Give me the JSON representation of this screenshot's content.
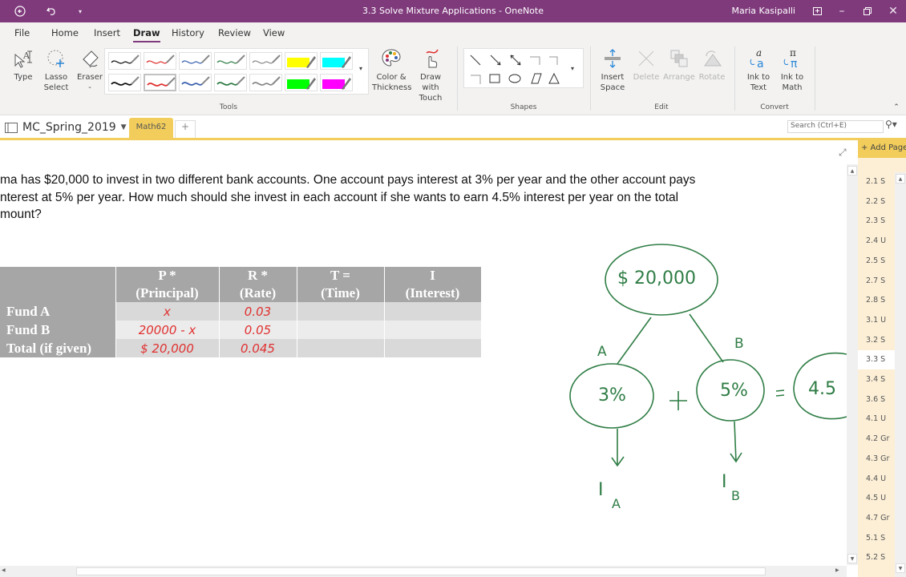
{
  "window": {
    "title": "3.3 Solve Mixture Applications  -  OneNote",
    "user": "Maria Kasipalli"
  },
  "menu": {
    "tabs": [
      "File",
      "Home",
      "Insert",
      "Draw",
      "History",
      "Review",
      "View"
    ],
    "active": "Draw"
  },
  "ribbon": {
    "tools": {
      "type_label": "Type",
      "lasso_label1": "Lasso",
      "lasso_label2": "Select",
      "eraser_label": "Eraser",
      "eraser_sub": "-",
      "color_label1": "Color &",
      "color_label2": "Thickness",
      "touch_label1": "Draw with",
      "touch_label2": "Touch",
      "group": "Tools"
    },
    "pens": [
      {
        "color": "#111111",
        "kind": "pen"
      },
      {
        "color": "#e0302f",
        "kind": "pen"
      },
      {
        "color": "#3b62b0",
        "kind": "pen"
      },
      {
        "color": "#2f7d45",
        "kind": "pen"
      },
      {
        "color": "#8a8a8a",
        "kind": "pen"
      },
      {
        "color": "#ffff00",
        "kind": "highlighter"
      },
      {
        "color": "#00ffff",
        "kind": "highlighter"
      },
      {
        "color": "#111111",
        "kind": "pen"
      },
      {
        "color": "#e0302f",
        "kind": "pen",
        "selected": true
      },
      {
        "color": "#3b62b0",
        "kind": "pen"
      },
      {
        "color": "#2f7d45",
        "kind": "pen"
      },
      {
        "color": "#8a8a8a",
        "kind": "pen"
      },
      {
        "color": "#00ff00",
        "kind": "highlighter"
      },
      {
        "color": "#ff00ff",
        "kind": "highlighter"
      }
    ],
    "shapes_group": "Shapes",
    "edit": {
      "insert_space1": "Insert",
      "insert_space2": "Space",
      "delete": "Delete",
      "arrange": "Arrange",
      "rotate": "Rotate",
      "group": "Edit"
    },
    "convert": {
      "ink_text1": "Ink to",
      "ink_text2": "Text",
      "ink_math1": "Ink to",
      "ink_math2": "Math",
      "group": "Convert"
    }
  },
  "notebook": {
    "name": "MC_Spring_2019",
    "section": "Math62",
    "add_section": "+",
    "search_placeholder": "Search (Ctrl+E)"
  },
  "page": {
    "problem_lines": [
      "ma has $20,000 to invest in two different bank accounts. One account pays interest at 3% per year and the other account pays",
      "nterest at 5% per year. How much should she invest in each account if she wants to earn 4.5% interest per year on the total",
      "mount?"
    ],
    "table": {
      "header_top": [
        "",
        "P      *",
        "R      *",
        "T      =",
        "I"
      ],
      "header_bottom": [
        "",
        "(Principal)",
        "(Rate)",
        "(Time)",
        "(Interest)"
      ],
      "rows": [
        {
          "label": "Fund A",
          "principal": "x",
          "rate": "0.03",
          "time": "",
          "interest": ""
        },
        {
          "label": "Fund B",
          "principal": "20000 - x",
          "rate": "0.05",
          "time": "",
          "interest": ""
        },
        {
          "label": "Total (if given)",
          "principal": "$ 20,000",
          "rate": "0.045",
          "time": "",
          "interest": ""
        }
      ]
    },
    "diagram": {
      "top": "$ 20,000",
      "left_label": "A",
      "right_label": "B",
      "left_node": "3%",
      "plus": "+",
      "right_node": "5%",
      "equals": "=",
      "result_node": "4.5",
      "left_out": "I",
      "left_out_sub": "A",
      "right_out": "I",
      "right_out_sub": "B"
    }
  },
  "pages_panel": {
    "add_page": "+ Add Page",
    "items": [
      "2.1 S",
      "2.2 S",
      "2.3 S",
      "2.4 U",
      "2.5 S",
      "2.7 S",
      "2.8 S",
      "3.1 U",
      "3.2 S",
      "3.3 S",
      "3.4 S",
      "3.6 S",
      "4.1 U",
      "4.2 Gr",
      "4.3 Gr",
      "4.4 U",
      "4.5 U",
      "4.7 Gr",
      "5.1 S",
      "5.2 S"
    ],
    "active": "3.3 S"
  },
  "colors": {
    "brand": "#7f3a7c",
    "section": "#f2cd5b",
    "ink_red": "#e0302f",
    "ink_green": "#2f7d45"
  }
}
